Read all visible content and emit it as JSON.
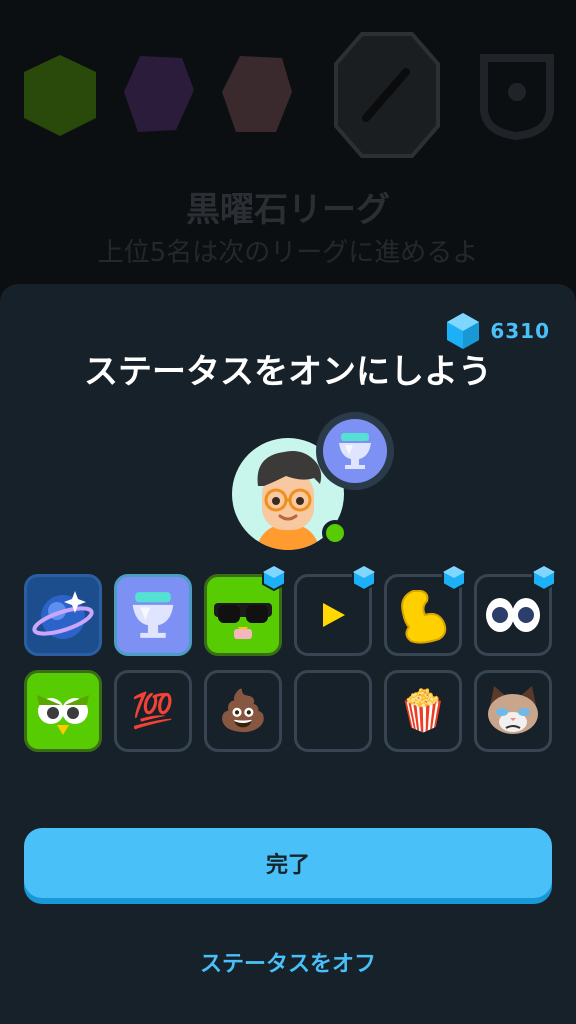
{
  "background": {
    "league_title": "黒曜石リーグ",
    "league_subtitle": "上位5名は次のリーグに進めるよ"
  },
  "gems": {
    "count": "6310"
  },
  "sheet": {
    "title": "ステータスをオンにしよう"
  },
  "statuses": [
    {
      "id": "planet",
      "icon": "planet-status-icon",
      "locked": false
    },
    {
      "id": "trophy",
      "icon": "trophy-status-icon",
      "locked": false,
      "selected": true
    },
    {
      "id": "sunglasses-owl",
      "icon": "sunglasses-owl-icon",
      "locked": true
    },
    {
      "id": "play",
      "icon": "play-triangle-icon",
      "locked": true
    },
    {
      "id": "muscle",
      "icon": "yellow-arm-icon",
      "locked": true
    },
    {
      "id": "eyes",
      "icon": "eyes-icon",
      "locked": true
    },
    {
      "id": "angry-owl",
      "icon": "green-owl-icon",
      "locked": false
    },
    {
      "id": "hundred",
      "icon": "hundred-points-emoji",
      "emoji": "💯",
      "locked": false
    },
    {
      "id": "poop",
      "icon": "poop-emoji",
      "emoji": "💩",
      "locked": false
    },
    {
      "id": "empty",
      "icon": "empty-slot",
      "locked": false
    },
    {
      "id": "popcorn",
      "icon": "popcorn-emoji",
      "emoji": "🍿",
      "locked": false
    },
    {
      "id": "cat",
      "icon": "grumpy-cat-icon",
      "locked": false
    }
  ],
  "buttons": {
    "done": "完了",
    "turn_off": "ステータスをオフ"
  },
  "colors": {
    "accent": "#49c0f8",
    "online": "#58cc02"
  }
}
